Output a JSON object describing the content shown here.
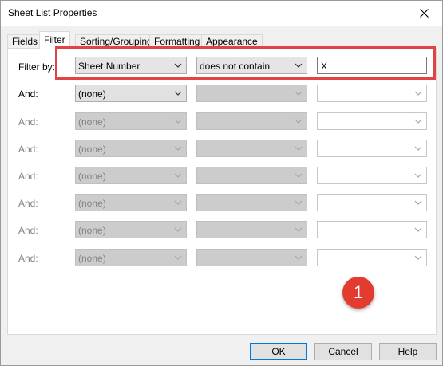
{
  "window": {
    "title": "Sheet List Properties"
  },
  "tabs": [
    {
      "label": "Fields"
    },
    {
      "label": "Filter"
    },
    {
      "label": "Sorting/Grouping"
    },
    {
      "label": "Formatting"
    },
    {
      "label": "Appearance"
    }
  ],
  "filters": {
    "filter_by_label": "Filter by:",
    "and_label": "And:",
    "row1": {
      "field": "Sheet Number",
      "condition": "does not contain",
      "value": "X"
    },
    "row2": {
      "field": "(none)"
    },
    "row3": {
      "field": "(none)"
    },
    "row4": {
      "field": "(none)"
    },
    "row5": {
      "field": "(none)"
    },
    "row6": {
      "field": "(none)"
    },
    "row7": {
      "field": "(none)"
    },
    "row8": {
      "field": "(none)"
    }
  },
  "annotation": {
    "number": "1",
    "color": "#e23c31",
    "highlight_color": "#e04545"
  },
  "buttons": {
    "ok": "OK",
    "cancel": "Cancel",
    "help": "Help"
  }
}
